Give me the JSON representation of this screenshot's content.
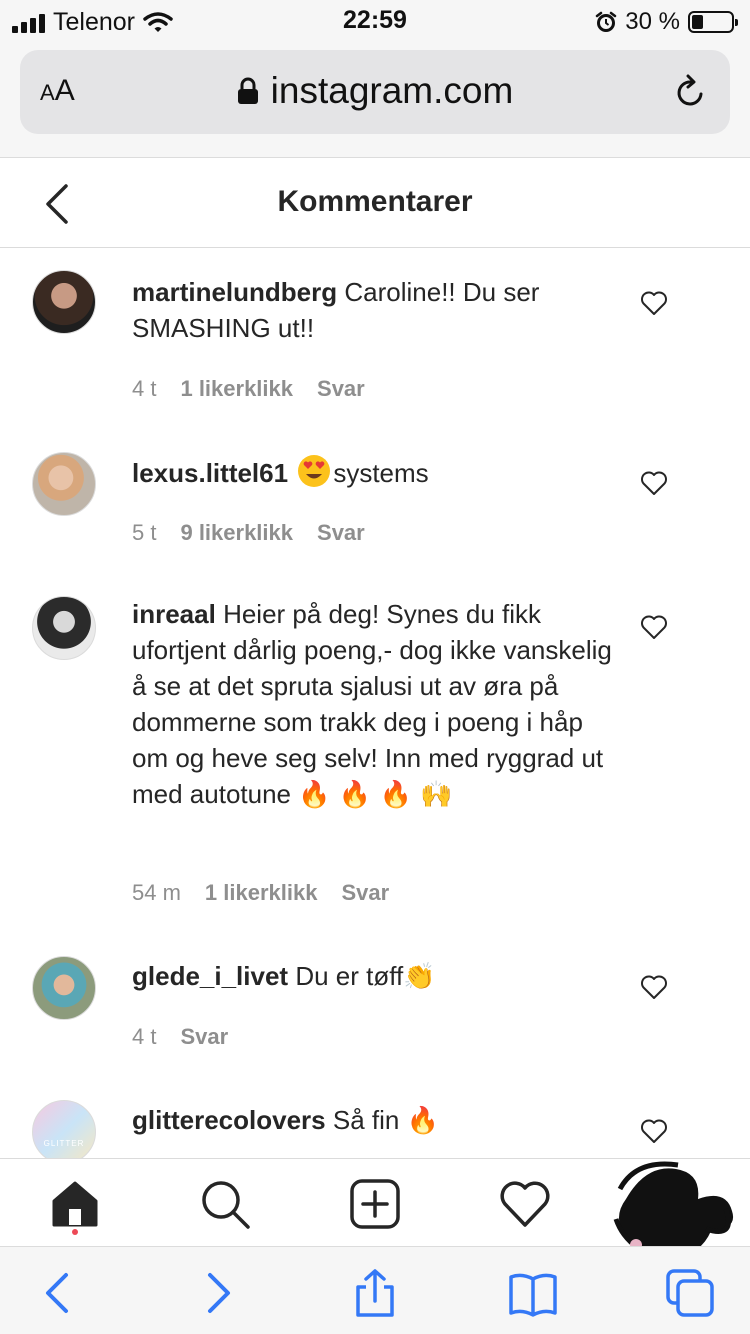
{
  "status_bar": {
    "carrier": "Telenor",
    "time": "22:59",
    "battery_percent": "30 %",
    "battery_level": 0.3,
    "icons": [
      "signal-icon",
      "wifi-icon",
      "alarm-icon",
      "battery-icon"
    ]
  },
  "browser": {
    "text_size_label_big": "A",
    "text_size_label_small": "A",
    "url": "instagram.com"
  },
  "header": {
    "title": "Kommentarer"
  },
  "comments": [
    {
      "username": "martinelundberg",
      "text": "Caroline!! Du ser SMASHING ut!!",
      "time": "4 t",
      "likes": "1 likerklikk",
      "reply": "Svar"
    },
    {
      "username": "lexus.littel61",
      "text": "systems",
      "time": "5 t",
      "likes": "9 likerklikk",
      "reply": "Svar"
    },
    {
      "username": "inreaal",
      "text": "Heier på deg! Synes du fikk ufortjent dårlig poeng,- dog ikke vanskelig å se at det spruta sjalusi ut av øra på dommerne som trakk deg i poeng i håp om og heve seg selv! Inn med ryggrad ut med autotune",
      "emojis": "🔥 🔥 🔥 🙌",
      "time": "54 m",
      "likes": "1 likerklikk",
      "reply": "Svar"
    },
    {
      "username": "glede_i_livet",
      "text": "Du er tøff",
      "emojis": "👏",
      "time": "4 t",
      "reply": "Svar"
    },
    {
      "username": "glitterecolovers",
      "text": "Så fin",
      "emojis": "🔥",
      "avatar_text": "GLITTER"
    }
  ],
  "nav": {
    "icons": [
      "home-icon",
      "search-icon",
      "new-post-icon",
      "activity-heart-icon",
      "profile-avatar"
    ]
  },
  "safari_toolbar": {
    "icons": [
      "back-arrow-icon",
      "forward-arrow-icon",
      "share-icon",
      "bookmarks-icon",
      "tabs-icon"
    ]
  },
  "colors": {
    "link_blue": "#3478f6",
    "meta_gray": "#8e8e8e",
    "text": "#262626",
    "notification_dot": "#ed4956"
  }
}
